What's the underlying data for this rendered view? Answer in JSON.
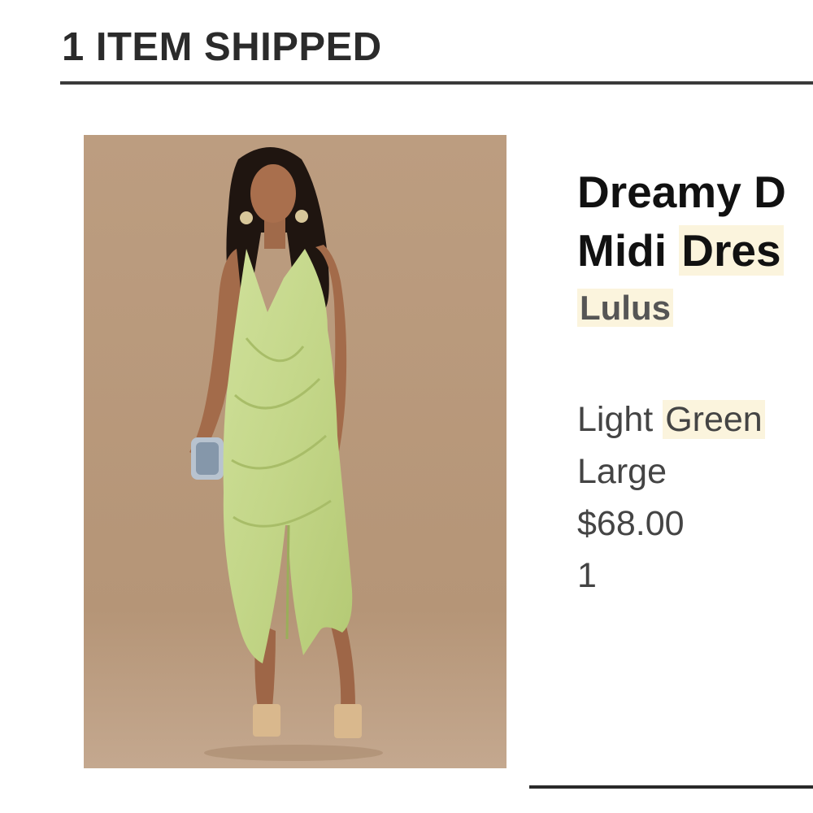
{
  "order": {
    "shipped_heading": "1 ITEM SHIPPED"
  },
  "item": {
    "image_alt": "Model wearing a light green sleeveless draped midi dress",
    "name_line1_part1": "Dreamy D",
    "name_line2_part1": "Midi",
    "name_line2_part2": "Dres",
    "brand": "Lulus",
    "color_part1": "Light",
    "color_part2": "Green",
    "size": "Large",
    "price": "$68.00",
    "quantity": "1"
  },
  "colors": {
    "highlight": "#fbf4dd",
    "rule": "#3a3a3a",
    "photo_background": "#b99a7e",
    "dress": "#c7d88a"
  }
}
